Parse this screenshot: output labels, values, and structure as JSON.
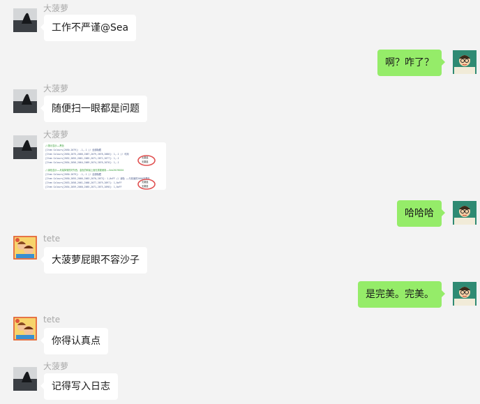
{
  "chat": {
    "messages": [
      {
        "side": "left",
        "sender": "大菠萝",
        "text": "工作不严谨@Sea"
      },
      {
        "side": "right",
        "text": "啊？咋了？"
      },
      {
        "side": "left",
        "sender": "大菠萝",
        "text": "随便扫一眼都是问题"
      },
      {
        "side": "left",
        "sender": "大菠萝",
        "type": "image",
        "image": {
          "lines_top": [
            "//报示显示……黑色",
            "[Item Colours[2050-2079]:       -1,-1        // 全部隐藏",
            "[Item Colours[2050,2075,2066,2067,2079,2078,2080]: 1,-1     // 可用",
            "[Item Colours[2052,2055,2061,2065,2071,2072,2077]: 1,-1",
            "[Item Colours[2054,2056,2064,2069,2074,2076,2070]: 1,-1"
          ],
          "lines_bottom": [
            "//绿色显示……月煌掉落的好东西，金色的和最上面无需被使用——Sea20190204",
            "[Item Colours[2050-2079]:       -1,-1        // 全部隐藏",
            "[Item Colours[2050,2055,2066,2063,2070,2073]:    1,0xFF  // 绿色 ……与前面的2000不要在",
            "[Item Colours[2053,2058,2061,2068,2077,2079,2097]:   1,0xFF",
            "[Item Colours[2054,2059,2060,2065,2071,2075,2098]:   1,0xFF"
          ],
          "circle_labels": [
            "无翻盖",
            "无翻盖",
            "无翻盖",
            "无翻盖"
          ]
        }
      },
      {
        "side": "right",
        "text": "哈哈哈"
      },
      {
        "side": "left",
        "sender": "tete",
        "text": "大菠萝屁眼不容沙子"
      },
      {
        "side": "right",
        "text": "是完美。完美。"
      },
      {
        "side": "left",
        "sender": "tete",
        "text": "你得认真点"
      },
      {
        "side": "left",
        "sender": "大菠萝",
        "text": "记得写入日志"
      }
    ]
  },
  "colors": {
    "background": "#f3f3f3",
    "bubble_left": "#ffffff",
    "bubble_right": "#95ec69",
    "sender_name": "#a8a8a8"
  },
  "icons": {
    "left_avatar_dabolo": "silhouette-photo-avatar",
    "left_avatar_tete": "cartoon-kids-avatar",
    "right_avatar": "cartoon-scholar-avatar"
  }
}
